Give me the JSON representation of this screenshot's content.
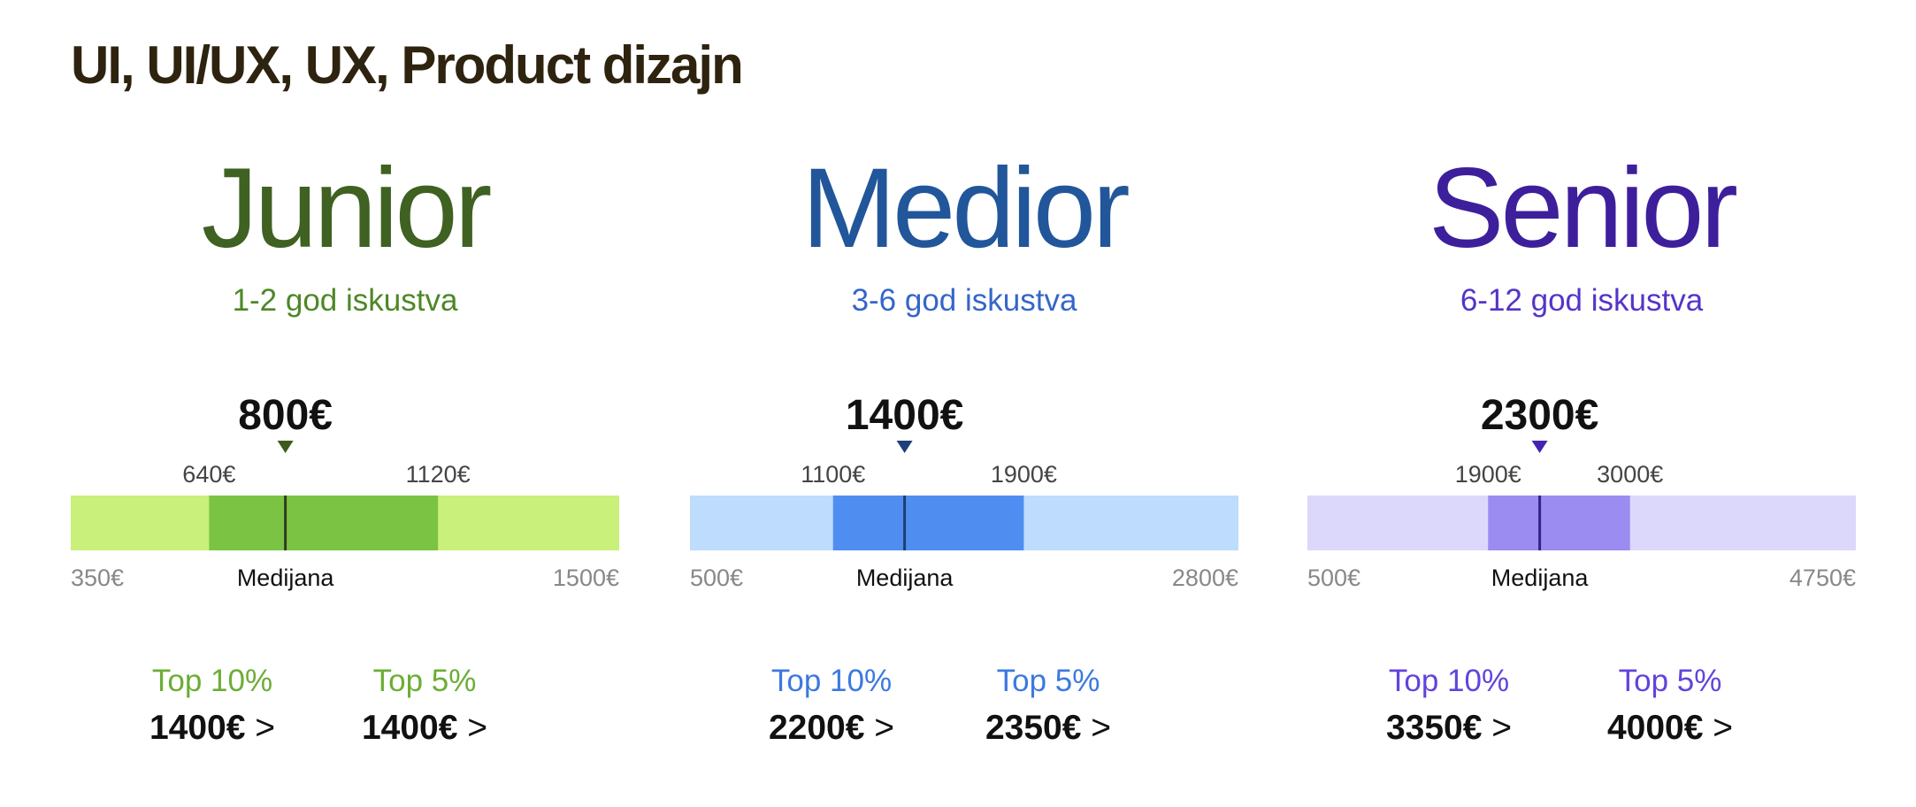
{
  "title": "UI, UI/UX, UX, Product dizajn",
  "chart_data": [
    {
      "type": "range",
      "level": "Junior",
      "experience": "1-2 god iskustva",
      "min": 350,
      "p25": 640,
      "median": 800,
      "p75": 1120,
      "max": 1500,
      "labels": {
        "min": "350€",
        "p25": "640€",
        "median": "800€",
        "p75": "1120€",
        "max": "1500€",
        "median_caption": "Medijana"
      },
      "top": [
        {
          "label": "Top 10%",
          "amount": "1400€",
          "suffix": " >"
        },
        {
          "label": "Top 5%",
          "amount": "1400€",
          "suffix": " >"
        }
      ],
      "colors": {
        "title": "#3f6121",
        "subtitle": "#4d8727",
        "light": "#c9f07a",
        "mid": "#7bc443",
        "marker": "#2f3d20",
        "triangle": "#3d5a1c",
        "top_label": "#6bad35"
      }
    },
    {
      "type": "range",
      "level": "Medior",
      "experience": "3-6 god iskustva",
      "min": 500,
      "p25": 1100,
      "median": 1400,
      "p75": 1900,
      "max": 2800,
      "labels": {
        "min": "500€",
        "p25": "1100€",
        "median": "1400€",
        "p75": "1900€",
        "max": "2800€",
        "median_caption": "Medijana"
      },
      "top": [
        {
          "label": "Top 10%",
          "amount": "2200€",
          "suffix": " >"
        },
        {
          "label": "Top 5%",
          "amount": "2350€",
          "suffix": " >"
        }
      ],
      "colors": {
        "title": "#22569a",
        "subtitle": "#3566c8",
        "light": "#bedcfd",
        "mid": "#4f8ef0",
        "marker": "#1d3e73",
        "triangle": "#1f3e7a",
        "top_label": "#3c79e0"
      }
    },
    {
      "type": "range",
      "level": "Senior",
      "experience": "6-12 god iskustva",
      "min": 500,
      "p25": 1900,
      "median": 2300,
      "p75": 3000,
      "max": 4750,
      "labels": {
        "min": "500€",
        "p25": "1900€",
        "median": "2300€",
        "p75": "3000€",
        "max": "4750€",
        "median_caption": "Medijana"
      },
      "top": [
        {
          "label": "Top 10%",
          "amount": "3350€",
          "suffix": " >"
        },
        {
          "label": "Top 5%",
          "amount": "4000€",
          "suffix": " >"
        }
      ],
      "colors": {
        "title": "#3d1f9c",
        "subtitle": "#5534c8",
        "light": "#dbd8fb",
        "mid": "#9b8cf2",
        "marker": "#33228a",
        "triangle": "#4326ad",
        "top_label": "#6343dc"
      }
    }
  ]
}
